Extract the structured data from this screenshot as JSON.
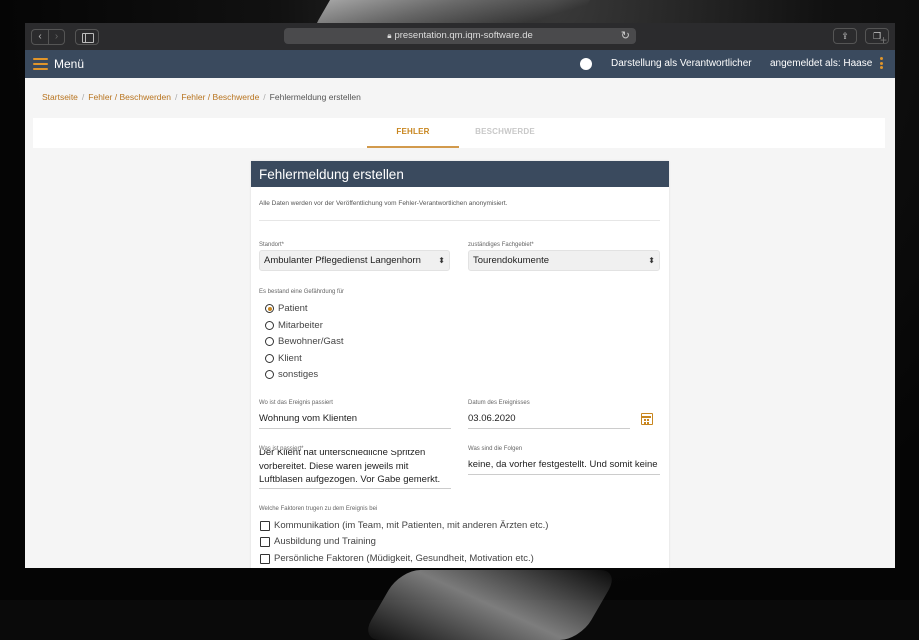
{
  "browser": {
    "url": "presentation.qm.iqm-software.de"
  },
  "appbar": {
    "menu_label": "Menü",
    "presentation_toggle_label": "Darstellung als Verantwortlicher",
    "user_label": "angemeldet als: Haase"
  },
  "breadcrumb": {
    "items": [
      "Startseite",
      "Fehler / Beschwerden",
      "Fehler / Beschwerde"
    ],
    "current": "Fehlermeldung erstellen"
  },
  "tabs": {
    "fehler": "FEHLER",
    "beschwerde": "BESCHWERDE",
    "active": "FEHLER"
  },
  "form": {
    "title": "Fehlermeldung erstellen",
    "info": "Alle Daten werden vor der Veröffentlichung vom Fehler-Verantwortlichen anonymisiert.",
    "standort": {
      "label": "Standort*",
      "value": "Ambulanter Pflegedienst Langenhorn"
    },
    "fachgebiet": {
      "label": "zuständiges Fachgebiet*",
      "value": "Tourendokumente"
    },
    "gefaehrdung": {
      "label": "Es bestand eine Gefährdung für",
      "options": [
        "Patient",
        "Mitarbeiter",
        "Bewohner/Gast",
        "Klient",
        "sonstiges"
      ],
      "selected": "Patient"
    },
    "ort": {
      "label": "Wo ist das Ereignis passiert",
      "value": "Wohnung vom Klienten"
    },
    "datum": {
      "label": "Datum des Ereignisses",
      "value": "03.06.2020"
    },
    "was": {
      "label": "Was ist passiert*",
      "value": "Der Klient hat unterschiedliche Spritzen vorbereitet. Diese waren jeweils mit Luftblasen aufgezogen. Vor Gabe gemerkt."
    },
    "folgen": {
      "label": "Was sind die Folgen",
      "value": "keine, da vorher festgestellt. Und somit keine V"
    },
    "faktoren": {
      "label": "Welche Faktoren trugen zu dem Ereignis bei",
      "options": [
        "Kommunikation (im Team, mit Patienten, mit anderen Ärzten etc.)",
        "Ausbildung und Training",
        "Persönliche Faktoren (Müdigkeit, Gesundheit, Motivation etc.)"
      ]
    }
  }
}
